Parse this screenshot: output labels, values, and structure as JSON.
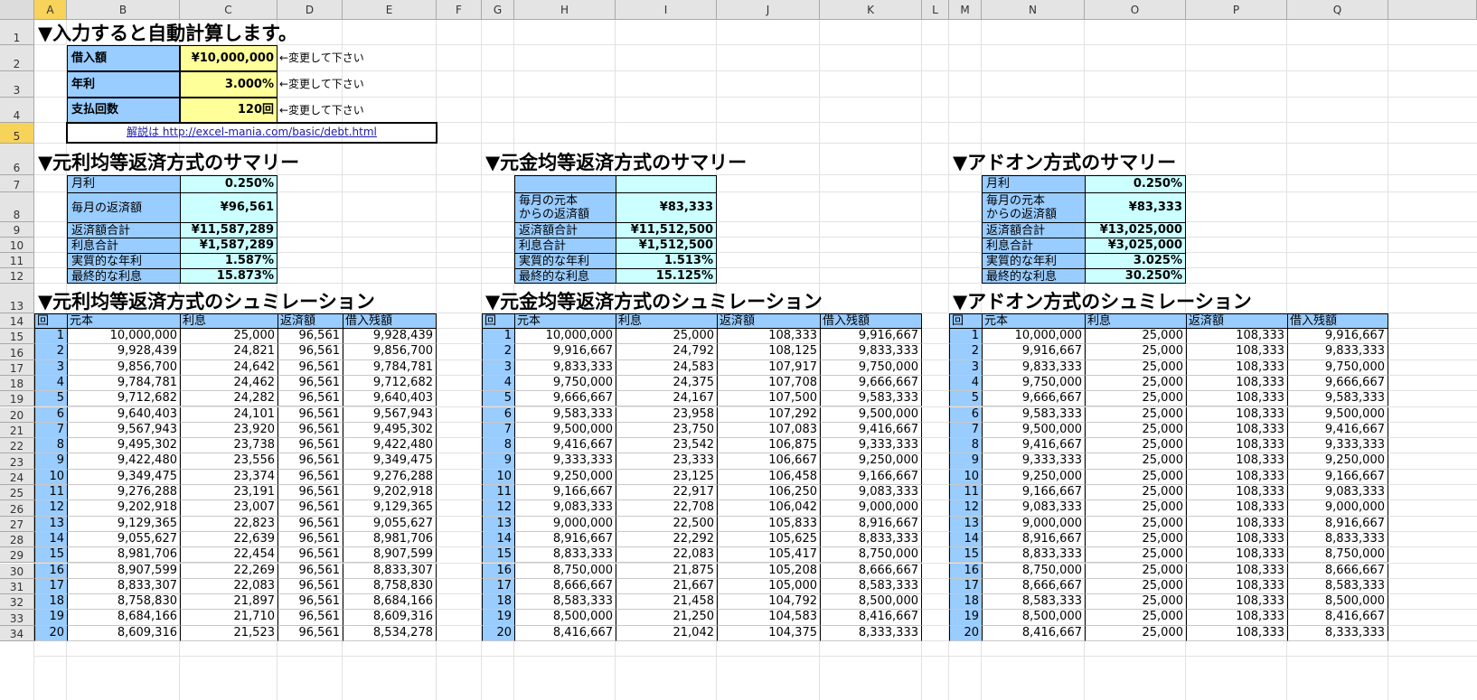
{
  "columns": [
    "A",
    "B",
    "C",
    "D",
    "E",
    "F",
    "G",
    "H",
    "I",
    "J",
    "K",
    "L",
    "M",
    "N",
    "O",
    "P",
    "Q"
  ],
  "rows": [
    "1",
    "2",
    "3",
    "4",
    "5",
    "6",
    "7",
    "8",
    "9",
    "10",
    "11",
    "12",
    "13",
    "14",
    "15",
    "16",
    "17",
    "18",
    "19",
    "20",
    "21",
    "22",
    "23",
    "24",
    "25",
    "26",
    "27",
    "28",
    "29",
    "30",
    "31",
    "32",
    "33",
    "34"
  ],
  "selected_row": "5",
  "selected_column": "A",
  "title": "▼入力すると自動計算します。",
  "inputs": {
    "loan_label": "借入額",
    "loan_value": "¥10,000,000",
    "rate_label": "年利",
    "rate_value": "3.000%",
    "count_label": "支払回数",
    "count_value": "120回",
    "change_note": "←変更して下さい"
  },
  "link_text": "解説は  http://excel-mania.com/basic/debt.html",
  "sections": [
    {
      "summary_title": "▼元利均等返済方式のサマリー",
      "sim_title": "▼元利均等返済方式のシュミレーション",
      "summary": [
        {
          "label": "月利",
          "value": "0.250%"
        },
        {
          "label": "毎月の返済額",
          "value": "¥96,561"
        },
        {
          "label": "返済額合計",
          "value": "¥11,587,289"
        },
        {
          "label": "利息合計",
          "value": "¥1,587,289"
        },
        {
          "label": "実質的な年利",
          "value": "1.587%"
        },
        {
          "label": "最終的な利息",
          "value": "15.873%"
        }
      ],
      "headers": [
        "回",
        "元本",
        "利息",
        "返済額",
        "借入残額"
      ],
      "rows": [
        [
          "1",
          "10,000,000",
          "25,000",
          "96,561",
          "9,928,439"
        ],
        [
          "2",
          "9,928,439",
          "24,821",
          "96,561",
          "9,856,700"
        ],
        [
          "3",
          "9,856,700",
          "24,642",
          "96,561",
          "9,784,781"
        ],
        [
          "4",
          "9,784,781",
          "24,462",
          "96,561",
          "9,712,682"
        ],
        [
          "5",
          "9,712,682",
          "24,282",
          "96,561",
          "9,640,403"
        ],
        [
          "6",
          "9,640,403",
          "24,101",
          "96,561",
          "9,567,943"
        ],
        [
          "7",
          "9,567,943",
          "23,920",
          "96,561",
          "9,495,302"
        ],
        [
          "8",
          "9,495,302",
          "23,738",
          "96,561",
          "9,422,480"
        ],
        [
          "9",
          "9,422,480",
          "23,556",
          "96,561",
          "9,349,475"
        ],
        [
          "10",
          "9,349,475",
          "23,374",
          "96,561",
          "9,276,288"
        ],
        [
          "11",
          "9,276,288",
          "23,191",
          "96,561",
          "9,202,918"
        ],
        [
          "12",
          "9,202,918",
          "23,007",
          "96,561",
          "9,129,365"
        ],
        [
          "13",
          "9,129,365",
          "22,823",
          "96,561",
          "9,055,627"
        ],
        [
          "14",
          "9,055,627",
          "22,639",
          "96,561",
          "8,981,706"
        ],
        [
          "15",
          "8,981,706",
          "22,454",
          "96,561",
          "8,907,599"
        ],
        [
          "16",
          "8,907,599",
          "22,269",
          "96,561",
          "8,833,307"
        ],
        [
          "17",
          "8,833,307",
          "22,083",
          "96,561",
          "8,758,830"
        ],
        [
          "18",
          "8,758,830",
          "21,897",
          "96,561",
          "8,684,166"
        ],
        [
          "19",
          "8,684,166",
          "21,710",
          "96,561",
          "8,609,316"
        ],
        [
          "20",
          "8,609,316",
          "21,523",
          "96,561",
          "8,534,278"
        ]
      ]
    },
    {
      "summary_title": "▼元金均等返済方式のサマリー",
      "sim_title": "▼元金均等返済方式のシュミレーション",
      "summary": [
        {
          "label": "",
          "value": ""
        },
        {
          "label": "毎月の元本\nからの返済額",
          "value": "¥83,333"
        },
        {
          "label": "返済額合計",
          "value": "¥11,512,500"
        },
        {
          "label": "利息合計",
          "value": "¥1,512,500"
        },
        {
          "label": "実質的な年利",
          "value": "1.513%"
        },
        {
          "label": "最終的な利息",
          "value": "15.125%"
        }
      ],
      "headers": [
        "回",
        "元本",
        "利息",
        "返済額",
        "借入残額"
      ],
      "rows": [
        [
          "1",
          "10,000,000",
          "25,000",
          "108,333",
          "9,916,667"
        ],
        [
          "2",
          "9,916,667",
          "24,792",
          "108,125",
          "9,833,333"
        ],
        [
          "3",
          "9,833,333",
          "24,583",
          "107,917",
          "9,750,000"
        ],
        [
          "4",
          "9,750,000",
          "24,375",
          "107,708",
          "9,666,667"
        ],
        [
          "5",
          "9,666,667",
          "24,167",
          "107,500",
          "9,583,333"
        ],
        [
          "6",
          "9,583,333",
          "23,958",
          "107,292",
          "9,500,000"
        ],
        [
          "7",
          "9,500,000",
          "23,750",
          "107,083",
          "9,416,667"
        ],
        [
          "8",
          "9,416,667",
          "23,542",
          "106,875",
          "9,333,333"
        ],
        [
          "9",
          "9,333,333",
          "23,333",
          "106,667",
          "9,250,000"
        ],
        [
          "10",
          "9,250,000",
          "23,125",
          "106,458",
          "9,166,667"
        ],
        [
          "11",
          "9,166,667",
          "22,917",
          "106,250",
          "9,083,333"
        ],
        [
          "12",
          "9,083,333",
          "22,708",
          "106,042",
          "9,000,000"
        ],
        [
          "13",
          "9,000,000",
          "22,500",
          "105,833",
          "8,916,667"
        ],
        [
          "14",
          "8,916,667",
          "22,292",
          "105,625",
          "8,833,333"
        ],
        [
          "15",
          "8,833,333",
          "22,083",
          "105,417",
          "8,750,000"
        ],
        [
          "16",
          "8,750,000",
          "21,875",
          "105,208",
          "8,666,667"
        ],
        [
          "17",
          "8,666,667",
          "21,667",
          "105,000",
          "8,583,333"
        ],
        [
          "18",
          "8,583,333",
          "21,458",
          "104,792",
          "8,500,000"
        ],
        [
          "19",
          "8,500,000",
          "21,250",
          "104,583",
          "8,416,667"
        ],
        [
          "20",
          "8,416,667",
          "21,042",
          "104,375",
          "8,333,333"
        ]
      ]
    },
    {
      "summary_title": "▼アドオン方式のサマリー",
      "sim_title": "▼アドオン方式のシュミレーション",
      "summary": [
        {
          "label": "月利",
          "value": "0.250%"
        },
        {
          "label": "毎月の元本\nからの返済額",
          "value": "¥83,333"
        },
        {
          "label": "返済額合計",
          "value": "¥13,025,000"
        },
        {
          "label": "利息合計",
          "value": "¥3,025,000"
        },
        {
          "label": "実質的な年利",
          "value": "3.025%"
        },
        {
          "label": "最終的な利息",
          "value": "30.250%"
        }
      ],
      "headers": [
        "回",
        "元本",
        "利息",
        "返済額",
        "借入残額"
      ],
      "rows": [
        [
          "1",
          "10,000,000",
          "25,000",
          "108,333",
          "9,916,667"
        ],
        [
          "2",
          "9,916,667",
          "25,000",
          "108,333",
          "9,833,333"
        ],
        [
          "3",
          "9,833,333",
          "25,000",
          "108,333",
          "9,750,000"
        ],
        [
          "4",
          "9,750,000",
          "25,000",
          "108,333",
          "9,666,667"
        ],
        [
          "5",
          "9,666,667",
          "25,000",
          "108,333",
          "9,583,333"
        ],
        [
          "6",
          "9,583,333",
          "25,000",
          "108,333",
          "9,500,000"
        ],
        [
          "7",
          "9,500,000",
          "25,000",
          "108,333",
          "9,416,667"
        ],
        [
          "8",
          "9,416,667",
          "25,000",
          "108,333",
          "9,333,333"
        ],
        [
          "9",
          "9,333,333",
          "25,000",
          "108,333",
          "9,250,000"
        ],
        [
          "10",
          "9,250,000",
          "25,000",
          "108,333",
          "9,166,667"
        ],
        [
          "11",
          "9,166,667",
          "25,000",
          "108,333",
          "9,083,333"
        ],
        [
          "12",
          "9,083,333",
          "25,000",
          "108,333",
          "9,000,000"
        ],
        [
          "13",
          "9,000,000",
          "25,000",
          "108,333",
          "8,916,667"
        ],
        [
          "14",
          "8,916,667",
          "25,000",
          "108,333",
          "8,833,333"
        ],
        [
          "15",
          "8,833,333",
          "25,000",
          "108,333",
          "8,750,000"
        ],
        [
          "16",
          "8,750,000",
          "25,000",
          "108,333",
          "8,666,667"
        ],
        [
          "17",
          "8,666,667",
          "25,000",
          "108,333",
          "8,583,333"
        ],
        [
          "18",
          "8,583,333",
          "25,000",
          "108,333",
          "8,500,000"
        ],
        [
          "19",
          "8,500,000",
          "25,000",
          "108,333",
          "8,416,667"
        ],
        [
          "20",
          "8,416,667",
          "25,000",
          "108,333",
          "8,333,333"
        ]
      ]
    }
  ]
}
